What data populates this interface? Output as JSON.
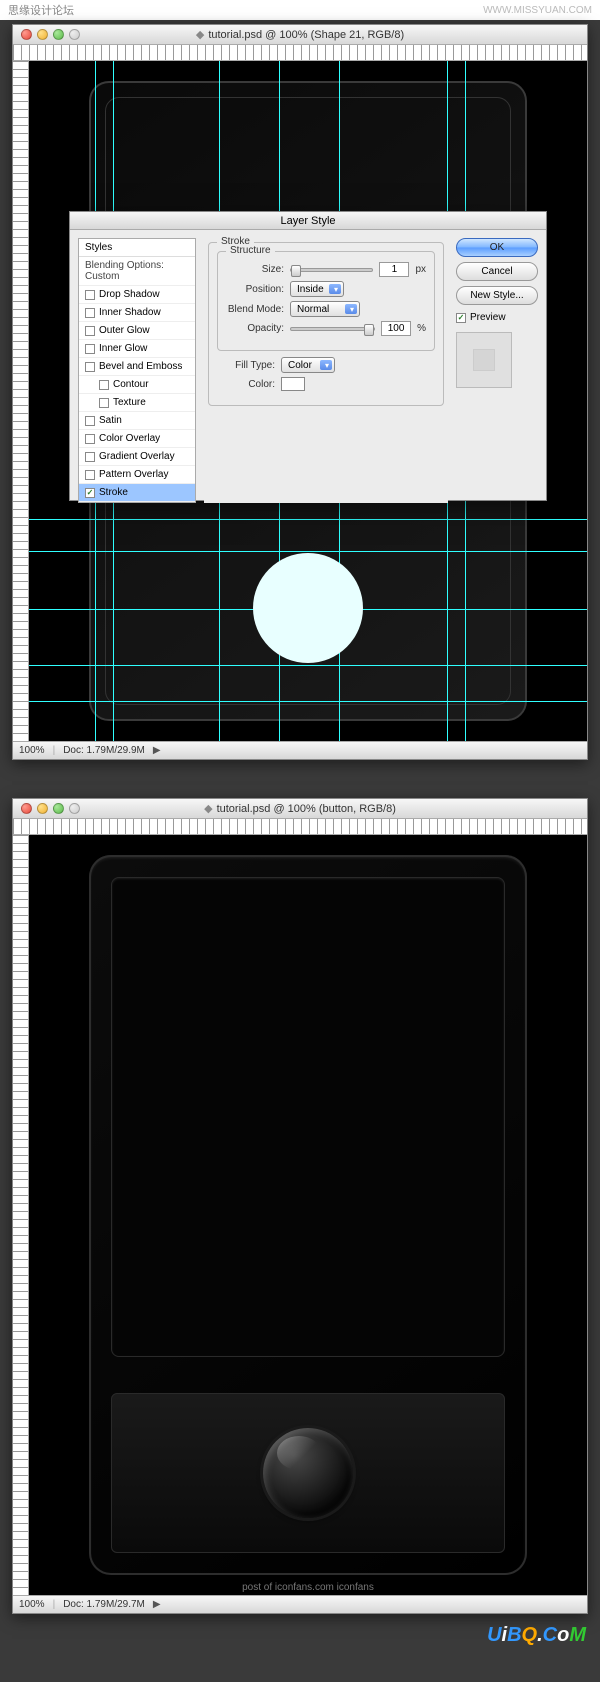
{
  "page_header": {
    "left_text": "思缘设计论坛",
    "right_text": "WWW.MISSYUAN.COM"
  },
  "window1": {
    "title": "tutorial.psd @ 100% (Shape 21, RGB/8)",
    "status": {
      "zoom": "100%",
      "doc": "Doc: 1.79M/29.9M"
    }
  },
  "window2": {
    "title": "tutorial.psd @ 100% (button, RGB/8)",
    "status": {
      "zoom": "100%",
      "doc": "Doc: 1.79M/29.7M"
    },
    "footer": "post of iconfans.com iconfans"
  },
  "dialog": {
    "title": "Layer Style",
    "styles_header": "Styles",
    "blending_label": "Blending Options: Custom",
    "effects": {
      "drop_shadow": "Drop Shadow",
      "inner_shadow": "Inner Shadow",
      "outer_glow": "Outer Glow",
      "inner_glow": "Inner Glow",
      "bevel": "Bevel and Emboss",
      "contour": "Contour",
      "texture": "Texture",
      "satin": "Satin",
      "color_overlay": "Color Overlay",
      "gradient_overlay": "Gradient Overlay",
      "pattern_overlay": "Pattern Overlay",
      "stroke": "Stroke"
    },
    "panel": {
      "group_title": "Stroke",
      "structure_title": "Structure",
      "size_label": "Size:",
      "size_value": "1",
      "size_unit": "px",
      "position_label": "Position:",
      "position_value": "Inside",
      "blend_label": "Blend Mode:",
      "blend_value": "Normal",
      "opacity_label": "Opacity:",
      "opacity_value": "100",
      "opacity_unit": "%",
      "fill_label": "Fill Type:",
      "fill_value": "Color",
      "color_label": "Color:"
    },
    "buttons": {
      "ok": "OK",
      "cancel": "Cancel",
      "new_style": "New Style...",
      "preview": "Preview"
    }
  },
  "brand": "UiBQ.CoM"
}
